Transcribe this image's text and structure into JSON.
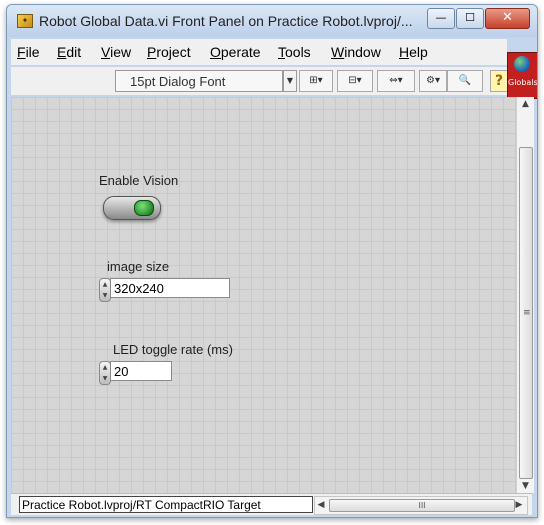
{
  "window": {
    "title": "Robot Global Data.vi Front Panel on Practice Robot.lvproj/...",
    "minimize_glyph": "—",
    "maximize_glyph": "☐",
    "close_glyph": "✕"
  },
  "menu": {
    "items": [
      {
        "mnemonic": "F",
        "rest": "ile"
      },
      {
        "mnemonic": "E",
        "rest": "dit"
      },
      {
        "mnemonic": "V",
        "rest": "iew"
      },
      {
        "mnemonic": "P",
        "rest": "roject"
      },
      {
        "mnemonic": "O",
        "rest": "perate"
      },
      {
        "mnemonic": "T",
        "rest": "ools"
      },
      {
        "mnemonic": "W",
        "rest": "indow"
      },
      {
        "mnemonic": "H",
        "rest": "elp"
      }
    ]
  },
  "toolbar": {
    "font_label": "15pt Dialog Font",
    "align_tool": "⊞▾",
    "distribute_tool": "⊟▾",
    "resize_tool": "⇔▾",
    "reorder_tool": "⚙▾",
    "search_tool": "🔍",
    "help_glyph": "?"
  },
  "globe_widget": {
    "label": "Globals",
    "accent": "#c21f1f"
  },
  "controls": {
    "enable_vision": {
      "label": "Enable Vision",
      "state": "on"
    },
    "image_size": {
      "label": "image size",
      "value": "320x240"
    },
    "led_rate": {
      "label": "LED toggle rate (ms)",
      "value": "20"
    }
  },
  "status": {
    "context": "Practice Robot.lvproj/RT CompactRIO Target",
    "scroll_grip": "III"
  },
  "icons": {
    "app": "labview-vi-icon",
    "spinner_up": "▲",
    "spinner_down": "▼",
    "arrow_up": "▲",
    "arrow_down": "▼",
    "arrow_left": "◀",
    "arrow_right": "▶",
    "grip": "≡"
  }
}
